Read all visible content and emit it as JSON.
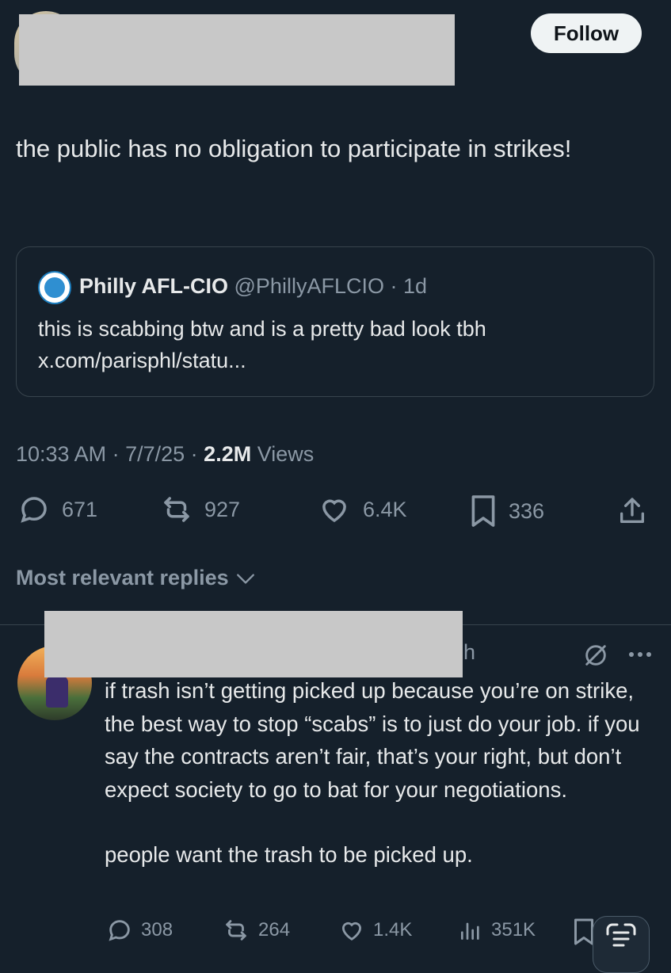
{
  "follow_label": "Follow",
  "tweet": {
    "text": "the public has no obligation to participate in strikes!",
    "quote": {
      "name": "Philly AFL-CIO",
      "handle": "@PhillyAFLCIO",
      "age": "· 1d",
      "text": "this is scabbing btw and is a pretty bad look tbh",
      "link": "x.com/parisphl/statu..."
    },
    "time": "10:33 AM",
    "date": "· 7/7/25 ·",
    "views_count": "2.2M",
    "views_label": "Views",
    "stats": {
      "replies": "671",
      "reposts": "927",
      "likes": "6.4K",
      "bookmarks": "336"
    }
  },
  "replies_sort_label": "Most relevant replies",
  "reply": {
    "time_fragment": "h",
    "paragraph1": "if trash isn’t getting picked up because you’re on strike, the best way to stop “scabs” is to just do your job. if you say the contracts aren’t fair, that’s your right, but don’t expect society to go to bat for your negotiations.",
    "paragraph2": "people want the trash to be picked up.",
    "stats": {
      "replies": "308",
      "reposts": "264",
      "likes": "1.4K",
      "views": "351K"
    }
  },
  "icons": {
    "reply": "reply-icon",
    "repost": "repost-icon",
    "like": "heart-icon",
    "bookmark": "bookmark-icon",
    "share": "share-icon",
    "views": "views-icon",
    "grok": "grok-icon",
    "more": "more-icon",
    "chevron": "chevron-down-icon"
  },
  "colors": {
    "background": "#15202b",
    "text": "#e7e9ea",
    "secondary": "#8b98a5",
    "border": "#38444d"
  }
}
